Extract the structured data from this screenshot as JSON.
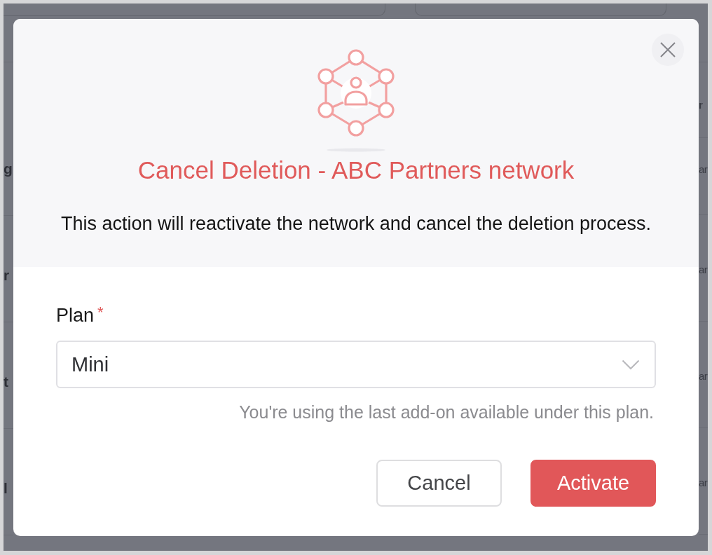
{
  "background_page": {
    "left_column": [
      "g",
      "r",
      "t",
      "l"
    ],
    "right_column": {
      "header": "r",
      "cells": [
        "ar",
        "ar",
        "ar",
        "ar"
      ]
    }
  },
  "dialog": {
    "title": "Cancel Deletion - ABC Partners network",
    "description": "This action will reactivate the network and cancel the deletion process.",
    "plan_field": {
      "label": "Plan",
      "required_mark": "*",
      "value": "Mini",
      "hint": "You're using the last add-on available under this plan."
    },
    "buttons": [
      {
        "label": "Cancel",
        "kind": "secondary"
      },
      {
        "label": "Activate",
        "kind": "primary"
      }
    ]
  }
}
